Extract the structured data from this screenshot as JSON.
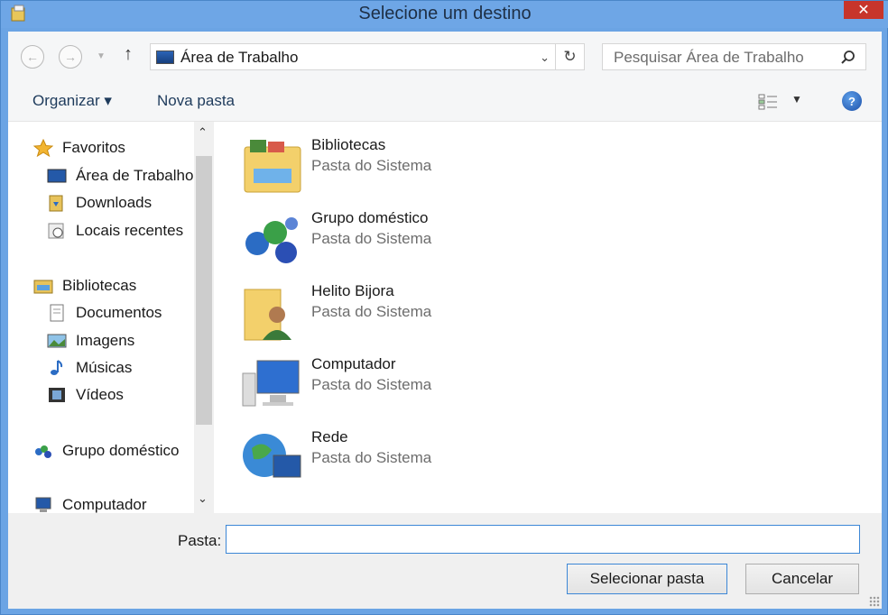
{
  "window": {
    "title": "Selecione um destino",
    "close_symbol": "✕"
  },
  "navigation": {
    "back_icon": "back-arrow-icon",
    "forward_icon": "forward-arrow-icon",
    "up_icon": "up-arrow-icon",
    "address_value": "Área de Trabalho",
    "search_placeholder": "Pesquisar Área de Trabalho"
  },
  "toolbar": {
    "organize_label": "Organizar ▾",
    "new_folder_label": "Nova pasta",
    "help_symbol": "?"
  },
  "sidebar": {
    "items": [
      {
        "label": "Favoritos",
        "icon": "star-icon"
      },
      {
        "label": "Área de Trabalho",
        "icon": "desktop-icon"
      },
      {
        "label": "Downloads",
        "icon": "downloads-icon"
      },
      {
        "label": "Locais recentes",
        "icon": "recent-places-icon"
      },
      {
        "label": "Bibliotecas",
        "icon": "libraries-icon"
      },
      {
        "label": "Documentos",
        "icon": "documents-icon"
      },
      {
        "label": "Imagens",
        "icon": "pictures-icon"
      },
      {
        "label": "Músicas",
        "icon": "music-icon"
      },
      {
        "label": "Vídeos",
        "icon": "videos-icon"
      },
      {
        "label": "Grupo doméstico",
        "icon": "homegroup-icon"
      },
      {
        "label": "Computador",
        "icon": "computer-icon"
      }
    ]
  },
  "content": {
    "entries": [
      {
        "name": "Bibliotecas",
        "type": "Pasta do Sistema",
        "icon": "libraries-folder-icon"
      },
      {
        "name": "Grupo doméstico",
        "type": "Pasta do Sistema",
        "icon": "homegroup-icon"
      },
      {
        "name": "Helito Bijora",
        "type": "Pasta do Sistema",
        "icon": "user-folder-icon"
      },
      {
        "name": "Computador",
        "type": "Pasta do Sistema",
        "icon": "computer-icon"
      },
      {
        "name": "Rede",
        "type": "Pasta do Sistema",
        "icon": "network-icon"
      }
    ]
  },
  "footer": {
    "folder_label": "Pasta:",
    "folder_value": "",
    "select_button": "Selecionar pasta",
    "cancel_button": "Cancelar"
  },
  "colors": {
    "title_bar": "#6ea6e6",
    "close_button": "#c7352b",
    "focus_border": "#3c87d6"
  }
}
